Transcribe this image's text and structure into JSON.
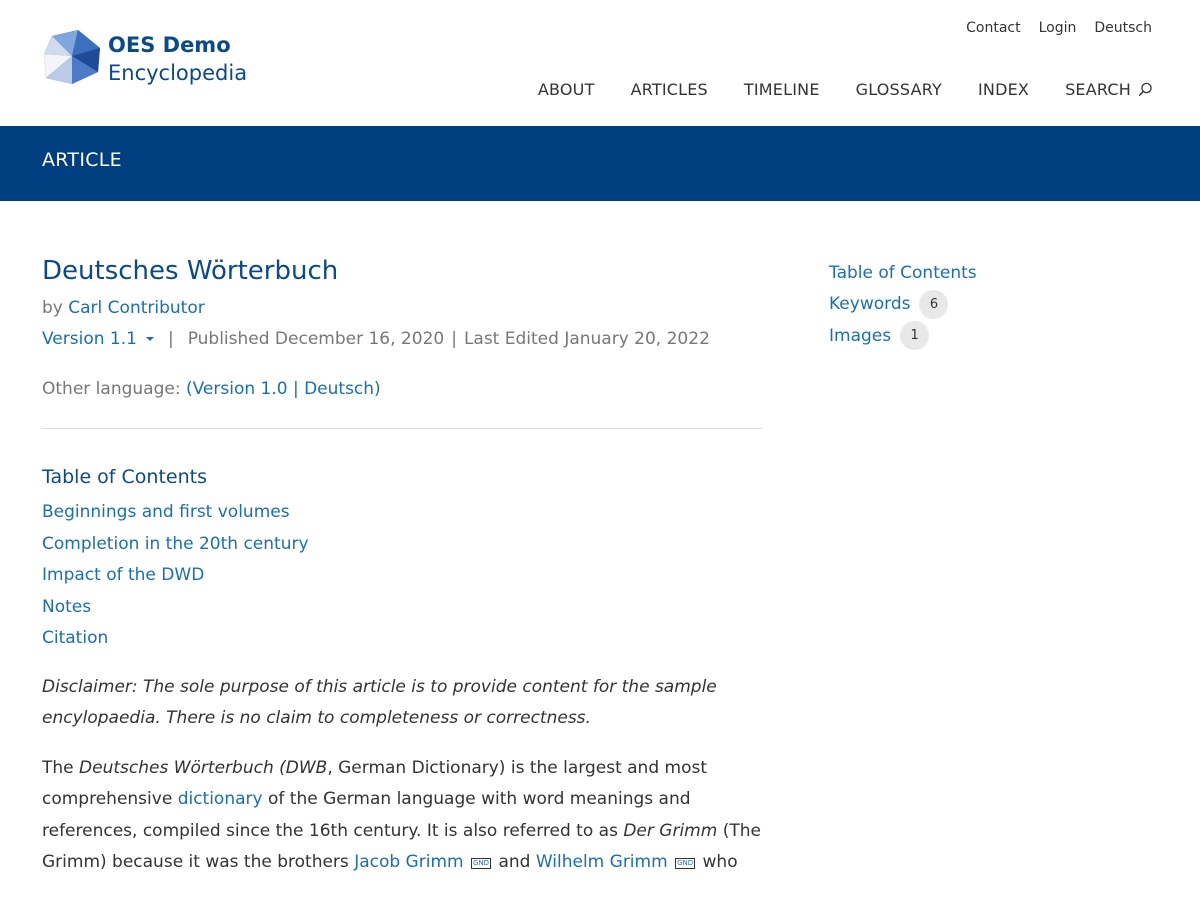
{
  "brand": {
    "line1": "OES Demo",
    "line2": "Encyclopedia",
    "logo_icon": "gem-logo-icon"
  },
  "util_nav": {
    "contact": "Contact",
    "login": "Login",
    "language": "Deutsch"
  },
  "main_nav": {
    "items": [
      "ABOUT",
      "ARTICLES",
      "TIMELINE",
      "GLOSSARY",
      "INDEX"
    ],
    "search_label": "SEARCH",
    "search_icon": "search-icon"
  },
  "banner": {
    "title": "ARTICLE"
  },
  "article": {
    "title": "Deutsches Wörterbuch",
    "by_prefix": "by",
    "author": "Carl Contributor",
    "version": "Version 1.1",
    "separator": "|",
    "published": "Published December 16, 2020",
    "last_edited": "Last Edited January 20, 2022",
    "other_language_label": "Other language:",
    "other_language_link": "(Version 1.0 | Deutsch)",
    "toc_title": "Table of Contents",
    "toc": [
      "Beginnings and first volumes",
      "Completion in the 20th century",
      "Impact of the DWD",
      "Notes",
      "Citation"
    ],
    "disclaimer": "Disclaimer: The sole purpose of this article is to provide content for the sample encylopaedia. There is no claim to completeness or correctness.",
    "body": {
      "p1_a": "The ",
      "p1_b": "Deutsches Wörterbuch (DWB",
      "p1_c": ", German Dictionary) is the largest and most comprehensive ",
      "p1_link1": "dictionary",
      "p1_d": " of the German language with word meanings and references, compiled since the 16th century. It is also referred to as ",
      "p1_e": "Der Grimm",
      "p1_f": " (The Grimm) because it was the brothers ",
      "p1_link2": "Jacob Grimm",
      "gnd": "GND",
      "p1_g": " and ",
      "p1_link3": "Wilhelm Grimm",
      "p1_h": " who"
    }
  },
  "sidebar": {
    "toc": "Table of Contents",
    "keywords": "Keywords",
    "keywords_count": "6",
    "images": "Images",
    "images_count": "1"
  },
  "colors": {
    "brand_blue": "#003f7f",
    "link_blue": "#1a6fb0",
    "title_blue": "#0a4a8b"
  }
}
